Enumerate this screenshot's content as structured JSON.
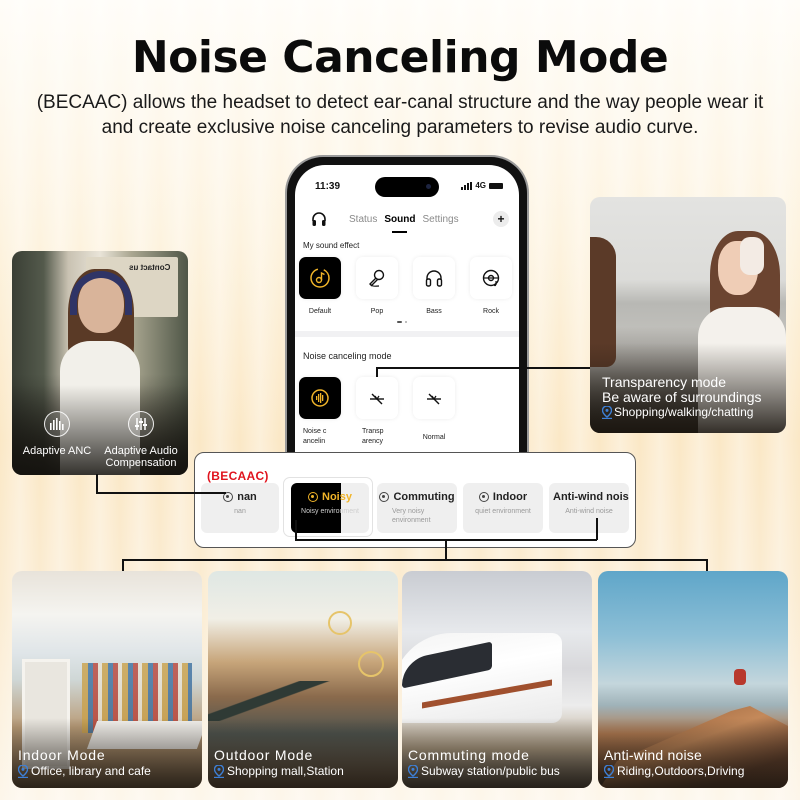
{
  "header": {
    "title": "Noise Canceling Mode",
    "subtitle": "(BECAAC) allows the headset to detect ear-canal structure and the way people wear it and create exclusive noise canceling parameters to revise audio curve."
  },
  "phone": {
    "status_time": "11:39",
    "network": "4G",
    "tabs": [
      {
        "label": "Status",
        "active": false
      },
      {
        "label": "Sound",
        "active": true
      },
      {
        "label": "Settings",
        "active": false
      }
    ],
    "add_label": "+",
    "sound_effect_label": "My sound effect",
    "sound_effects": [
      {
        "label": "Default",
        "icon": "music-disc-icon",
        "selected": true
      },
      {
        "label": "Pop",
        "icon": "microphone-icon",
        "selected": false
      },
      {
        "label": "Bass",
        "icon": "headphones-icon",
        "selected": false
      },
      {
        "label": "Rock",
        "icon": "vinyl-record-icon",
        "selected": false
      }
    ],
    "page_indicator": {
      "current": 1,
      "total": 2
    },
    "noise_mode_label": "Noise canceling mode",
    "noise_modes": [
      {
        "label": "Noise c ancelin",
        "icon": "sound-wave-icon",
        "selected": true
      },
      {
        "label": "Transp arency",
        "icon": "transparency-icon",
        "selected": false
      },
      {
        "label": "Normal",
        "icon": "normal-mode-icon",
        "selected": false
      }
    ]
  },
  "left_card": {
    "sign_text": "Contact us",
    "features": [
      {
        "label": "Adaptive ANC",
        "icon": "equalizer-bars-icon"
      },
      {
        "label": "Adaptive Audio Compensation",
        "icon": "sliders-icon"
      }
    ]
  },
  "right_card": {
    "title": "Transparency mode",
    "subtitle": "Be aware of surroundings",
    "location": "Shopping/walking/chatting"
  },
  "mode_strip": {
    "badge": "(BECAAC)",
    "modes": [
      {
        "name": "nan",
        "desc": "nan",
        "selected": false
      },
      {
        "name": "Noisy",
        "desc": "Noisy environment",
        "selected": true
      },
      {
        "name": "Commuting",
        "desc": "Very noisy environment",
        "selected": false
      },
      {
        "name": "Indoor",
        "desc": "quiet environment",
        "selected": false
      },
      {
        "name": "Anti-wind noise",
        "desc": "Anti-wind noise",
        "selected": false
      }
    ]
  },
  "scenes": [
    {
      "title": "Indoor Mode",
      "location": "Office, library and cafe"
    },
    {
      "title": "Outdoor Mode",
      "location": "Shopping mall,Station"
    },
    {
      "title": "Commuting mode",
      "location": "Subway station/public bus"
    },
    {
      "title": "Anti-wind noise",
      "location": "Riding,Outdoors,Driving"
    }
  ],
  "colors": {
    "accent_gold": "#f0b429",
    "badge_red": "#e0141e",
    "pin_blue": "#3d7fd6"
  }
}
